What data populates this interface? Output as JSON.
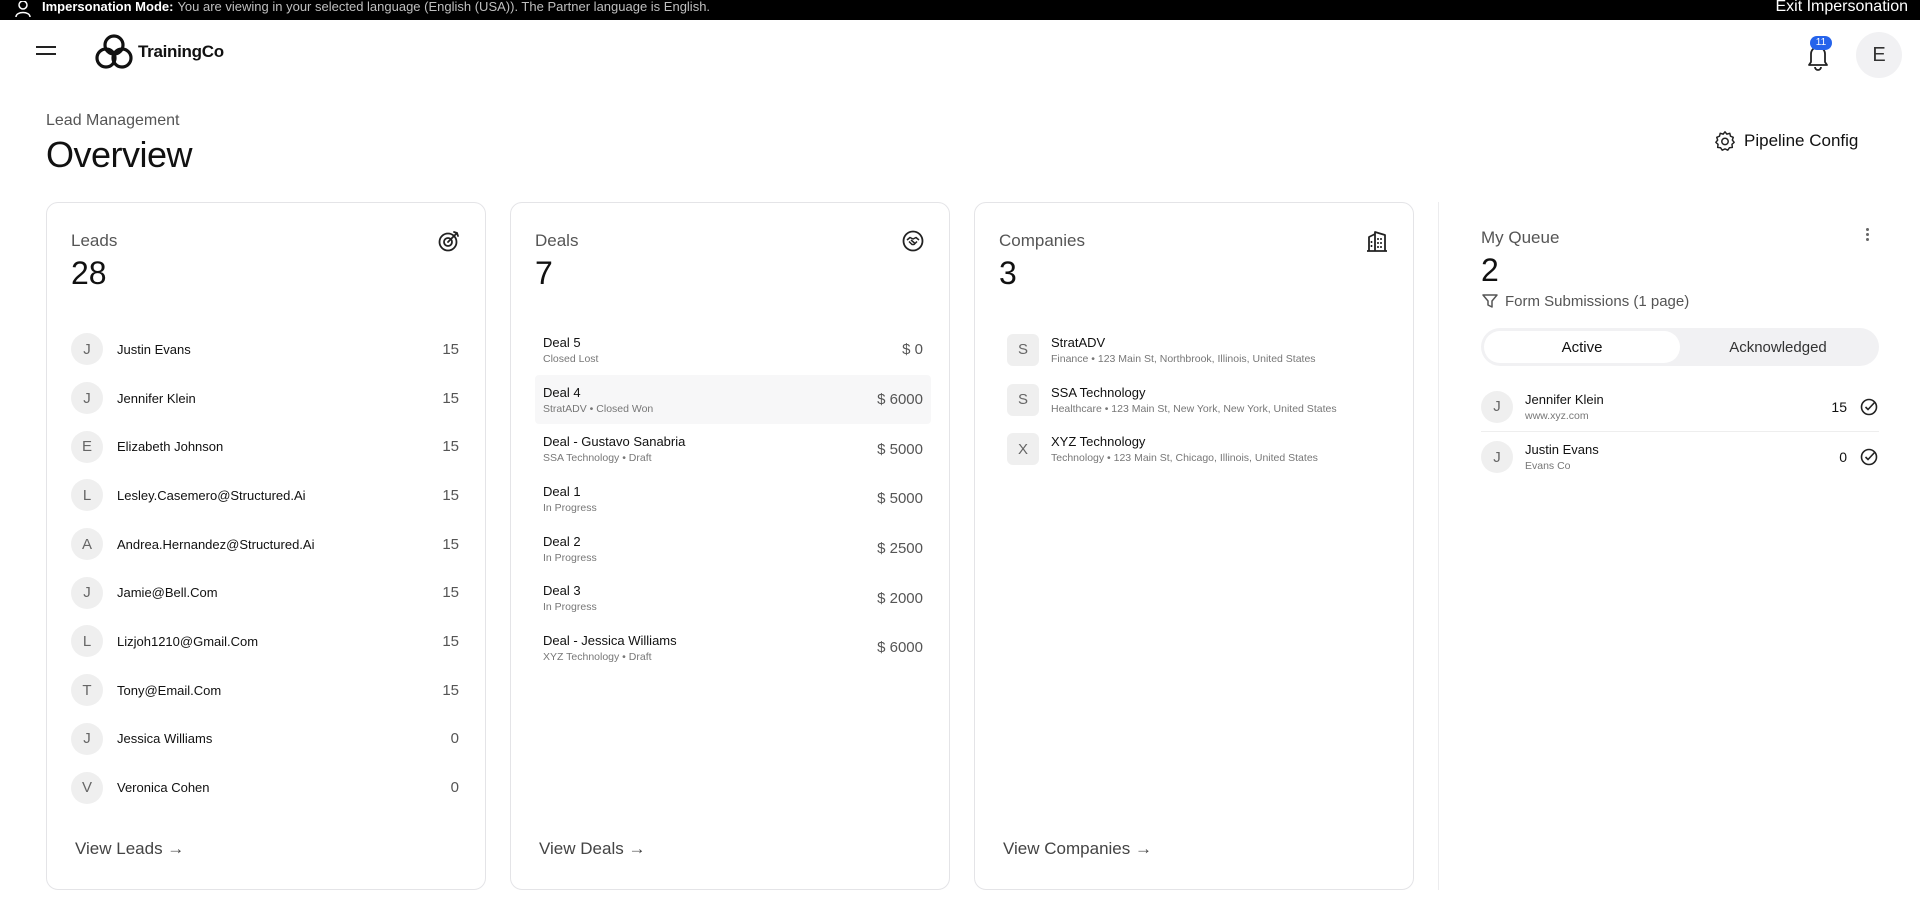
{
  "impersonation": {
    "label": "Impersonation Mode:",
    "message": "You are viewing in your selected language (English (USA)). The Partner language is English.",
    "exit": "Exit Impersonation"
  },
  "header": {
    "brand": "TrainingCo",
    "notification_count": "11",
    "user_initial": "E"
  },
  "page": {
    "breadcrumb": "Lead Management",
    "title": "Overview",
    "pipeline_config": "Pipeline Config"
  },
  "leads": {
    "title": "Leads",
    "count": "28",
    "footer": "View Leads →",
    "items": [
      {
        "initial": "J",
        "name": "Justin Evans",
        "score": "15"
      },
      {
        "initial": "J",
        "name": "Jennifer Klein",
        "score": "15"
      },
      {
        "initial": "E",
        "name": "Elizabeth Johnson",
        "score": "15"
      },
      {
        "initial": "L",
        "name": "Lesley.Casemero@Structured.Ai",
        "score": "15"
      },
      {
        "initial": "A",
        "name": "Andrea.Hernandez@Structured.Ai",
        "score": "15"
      },
      {
        "initial": "J",
        "name": "Jamie@Bell.Com",
        "score": "15"
      },
      {
        "initial": "L",
        "name": "Lizjoh1210@Gmail.Com",
        "score": "15"
      },
      {
        "initial": "T",
        "name": "Tony@Email.Com",
        "score": "15"
      },
      {
        "initial": "J",
        "name": "Jessica Williams",
        "score": "0"
      },
      {
        "initial": "V",
        "name": "Veronica Cohen",
        "score": "0"
      }
    ]
  },
  "deals": {
    "title": "Deals",
    "count": "7",
    "footer": "View Deals →",
    "items": [
      {
        "name": "Deal 5",
        "sub": "Closed Lost",
        "amount": "$ 0"
      },
      {
        "name": "Deal 4",
        "sub": "StratADV • Closed Won",
        "amount": "$ 6000"
      },
      {
        "name": "Deal - Gustavo Sanabria",
        "sub": "SSA Technology • Draft",
        "amount": "$ 5000"
      },
      {
        "name": "Deal 1",
        "sub": "In Progress",
        "amount": "$ 5000"
      },
      {
        "name": "Deal 2",
        "sub": "In Progress",
        "amount": "$ 2500"
      },
      {
        "name": "Deal 3",
        "sub": "In Progress",
        "amount": "$ 2000"
      },
      {
        "name": "Deal - Jessica Williams",
        "sub": "XYZ Technology • Draft",
        "amount": "$ 6000"
      }
    ]
  },
  "companies": {
    "title": "Companies",
    "count": "3",
    "footer": "View Companies →",
    "items": [
      {
        "initial": "S",
        "name": "StratADV",
        "sub": "Finance • 123 Main St, Northbrook, Illinois, United States"
      },
      {
        "initial": "S",
        "name": "SSA Technology",
        "sub": "Healthcare • 123 Main St, New York, New York, United States"
      },
      {
        "initial": "X",
        "name": "XYZ Technology",
        "sub": "Technology • 123 Main St, Chicago, Illinois, United States"
      }
    ]
  },
  "queue": {
    "title": "My Queue",
    "count": "2",
    "filter": "Form Submissions (1 page)",
    "tabs": [
      "Active",
      "Acknowledged"
    ],
    "items": [
      {
        "initial": "J",
        "name": "Jennifer Klein",
        "sub": "www.xyz.com",
        "score": "15"
      },
      {
        "initial": "J",
        "name": "Justin Evans",
        "sub": "Evans Co",
        "score": "0"
      }
    ]
  }
}
